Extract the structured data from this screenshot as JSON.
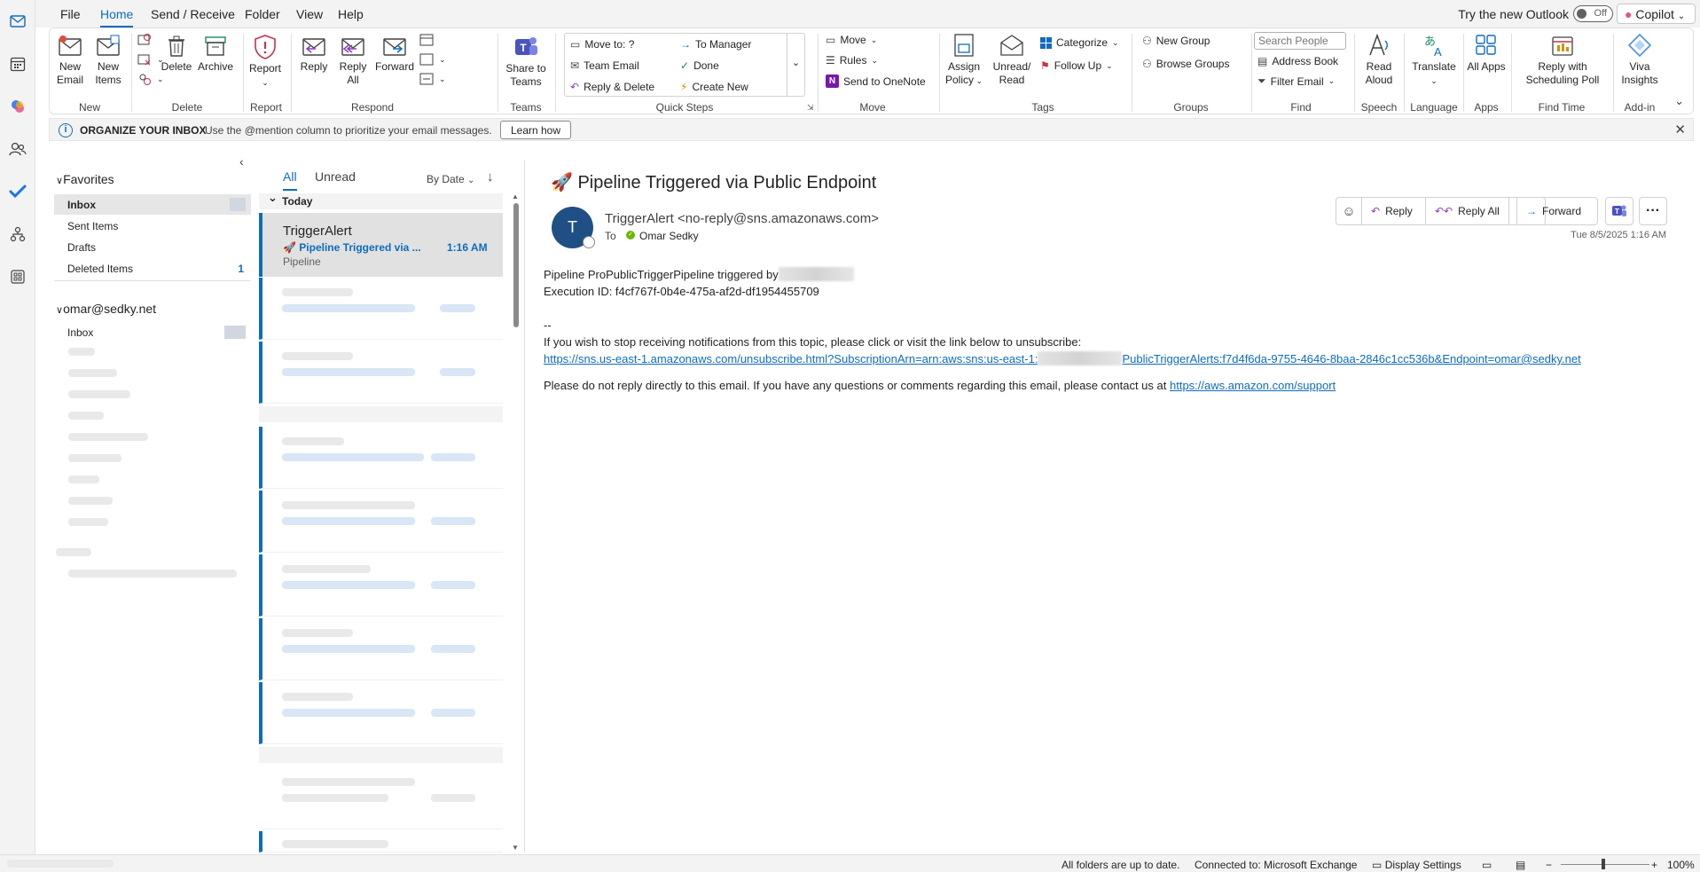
{
  "menu": {
    "tabs": [
      "File",
      "Home",
      "Send / Receive",
      "Folder",
      "View",
      "Help"
    ],
    "active_tab": "Home",
    "try_new_outlook": "Try the new Outlook",
    "toggle_state": "Off",
    "copilot": "Copilot"
  },
  "ribbon": {
    "new_email": "New Email",
    "new_items": "New Items",
    "group_new": "New",
    "delete": "Delete",
    "archive": "Archive",
    "group_delete": "Delete",
    "report": "Report",
    "group_report": "Report",
    "reply": "Reply",
    "reply_all": "Reply All",
    "forward": "Forward",
    "group_respond": "Respond",
    "share_to_teams": "Share to Teams",
    "group_teams": "Teams",
    "qs_move_to": "Move to: ?",
    "qs_team_email": "Team Email",
    "qs_reply_delete": "Reply & Delete",
    "qs_to_manager": "To Manager",
    "qs_done": "Done",
    "qs_create_new": "Create New",
    "group_quick_steps": "Quick Steps",
    "move": "Move",
    "rules": "Rules",
    "send_onenote": "Send to OneNote",
    "group_move": "Move",
    "assign_policy": "Assign Policy",
    "unread_read": "Unread/ Read",
    "categorize": "Categorize",
    "follow_up": "Follow Up",
    "group_tags": "Tags",
    "new_group": "New Group",
    "browse_groups": "Browse Groups",
    "group_groups": "Groups",
    "search_people_placeholder": "Search People",
    "address_book": "Address Book",
    "filter_email": "Filter Email",
    "group_find": "Find",
    "read_aloud": "Read Aloud",
    "group_speech": "Speech",
    "translate": "Translate",
    "group_language": "Language",
    "all_apps": "All Apps",
    "group_apps": "Apps",
    "reply_scheduling_poll": "Reply with Scheduling Poll",
    "group_find_time": "Find Time",
    "viva_insights": "Viva Insights",
    "group_addin": "Add-in"
  },
  "infobar": {
    "title": "ORGANIZE YOUR INBOX",
    "text": "Use the @mention column to prioritize your email messages.",
    "learn_how": "Learn how"
  },
  "folders": {
    "favorites_label": "Favorites",
    "favorites": [
      {
        "label": "Inbox",
        "count": ""
      },
      {
        "label": "Sent Items",
        "count": ""
      },
      {
        "label": "Drafts",
        "count": ""
      },
      {
        "label": "Deleted Items",
        "count": "1"
      }
    ],
    "account": "omar@sedky.net",
    "account_inbox": "Inbox"
  },
  "message_list": {
    "tab_all": "All",
    "tab_unread": "Unread",
    "sort_by": "By Date",
    "group_today": "Today",
    "selected": {
      "sender": "TriggerAlert",
      "subject": "Pipeline Triggered via ...",
      "time": "1:16 AM",
      "preview": "Pipeline"
    }
  },
  "reading": {
    "subject": "Pipeline Triggered via Public Endpoint",
    "avatar_initial": "T",
    "from": "TriggerAlert <no-reply@sns.amazonaws.com>",
    "to_label": "To",
    "to_name": "Omar Sedky",
    "reply": "Reply",
    "reply_all": "Reply All",
    "forward": "Forward",
    "date": "Tue 8/5/2025 1:16 AM",
    "body_line1": "Pipeline ProPublicTriggerPipeline triggered by",
    "body_line2": "Execution ID: f4cf767f-0b4e-475a-af2d-df1954455709",
    "body_sep": "--",
    "body_unsub_text": "If you wish to stop receiving notifications from this topic, please click or visit the link below to unsubscribe:",
    "unsub_link_part1": "https://sns.us-east-1.amazonaws.com/unsubscribe.html?SubscriptionArn=arn:aws:sns:us-east-1:",
    "unsub_link_part2": "PublicTriggerAlerts:f7d4f6da-9755-4646-8baa-2846c1cc536b&Endpoint=omar@sedky.net",
    "body_support_text": "Please do not reply directly to this email. If you have any questions or comments regarding this email, please contact us at",
    "support_link": "https://aws.amazon.com/support"
  },
  "statusbar": {
    "up_to_date": "All folders are up to date.",
    "connected": "Connected to: Microsoft Exchange",
    "display_settings": "Display Settings",
    "zoom_minus": "−",
    "zoom_plus": "+",
    "zoom": "100%"
  },
  "colors": {
    "accent": "#0f6cbd",
    "avatar": "#1f4f85",
    "ribbon_bg": "#ffffff",
    "chrome": "#f3f3f3"
  }
}
